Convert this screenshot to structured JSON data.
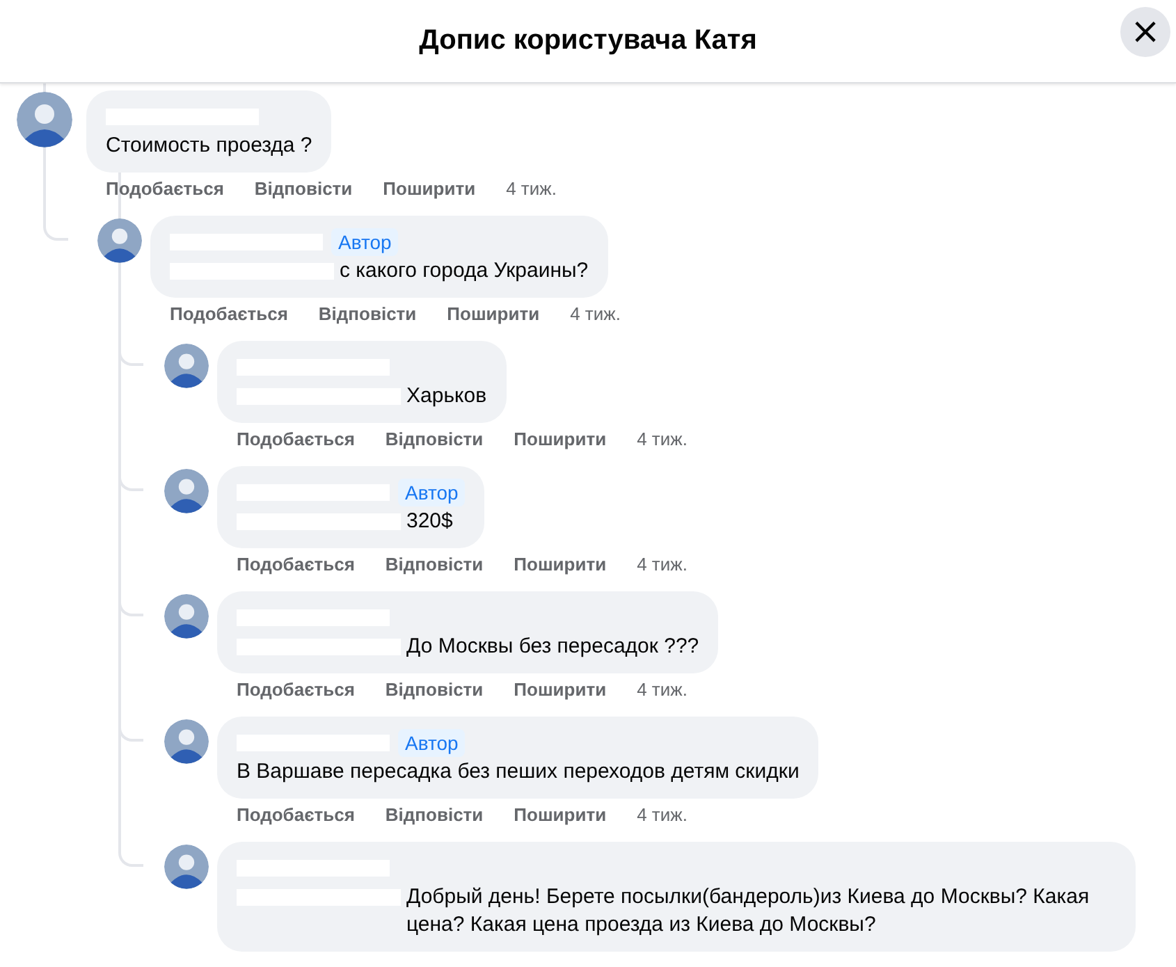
{
  "header": {
    "title": "Допис користувача Катя",
    "close": "×"
  },
  "comments": [
    {
      "mention_redacted": false,
      "text": "Стоимость проезда ?",
      "actions": [
        "Подобається",
        "Відповісти",
        "Поширити"
      ],
      "time": "4 тиж.",
      "children": [
        {
          "mention_redacted": true,
          "badge": "Автор",
          "text": "с какого города Украины?",
          "actions": [
            "Подобається",
            "Відповісти",
            "Поширити"
          ],
          "time": "4 тиж.",
          "children": [
            {
              "mention_redacted": true,
              "text": "Харьков",
              "actions": [
                "Подобається",
                "Відповісти",
                "Поширити"
              ],
              "time": "4 тиж."
            },
            {
              "mention_redacted": true,
              "badge": "Автор",
              "text": "320$",
              "actions": [
                "Подобається",
                "Відповісти",
                "Поширити"
              ],
              "time": "4 тиж."
            },
            {
              "mention_redacted": true,
              "text": "До Москвы без пересадок ???",
              "actions": [
                "Подобається",
                "Відповісти",
                "Поширити"
              ],
              "time": "4 тиж."
            },
            {
              "mention_redacted": false,
              "badge": "Автор",
              "text": "В Варшаве пересадка без пеших переходов детям скидки",
              "actions": [
                "Подобається",
                "Відповісти",
                "Поширити"
              ],
              "time": "4 тиж."
            },
            {
              "mention_redacted": true,
              "text": "Добрый день! Берете посылки(бандероль)из Киева до Москвы? Какая цена? Какая цена проезда из Киева до Москвы?"
            }
          ]
        }
      ]
    }
  ]
}
